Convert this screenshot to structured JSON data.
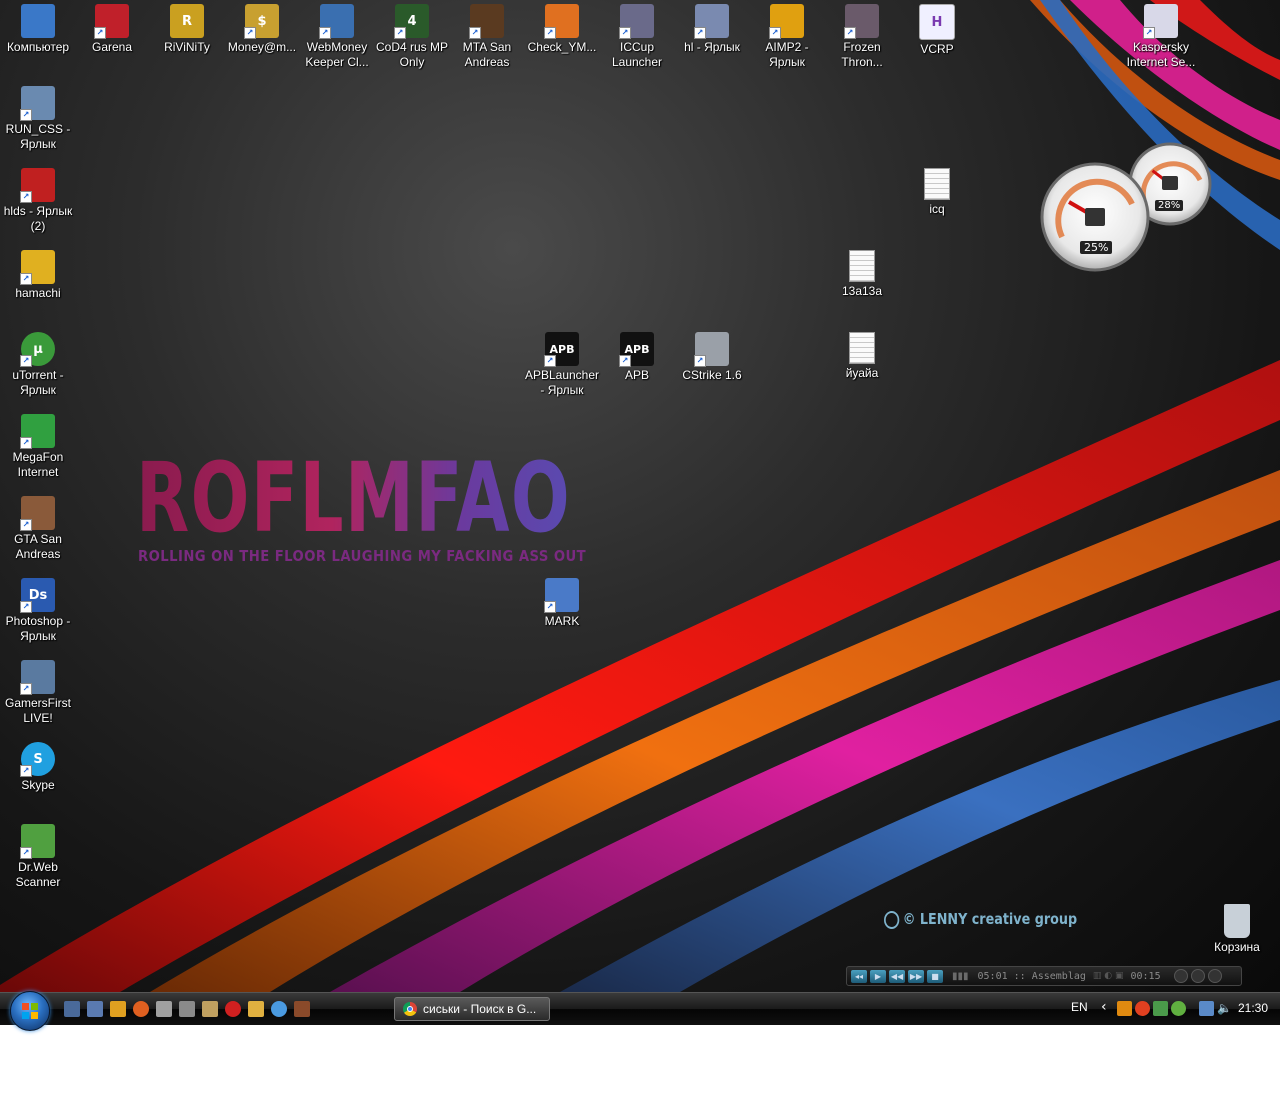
{
  "desktop": {
    "icons": [
      {
        "id": "computer",
        "label": "Компьютер",
        "glyph": "",
        "color": "#3a78c8"
      },
      {
        "id": "garena",
        "label": "Garena",
        "glyph": "",
        "color": "#c0202a"
      },
      {
        "id": "rivinity",
        "label": "RiViNiTy",
        "glyph": "R",
        "color": "#caa020"
      },
      {
        "id": "money",
        "label": "Money@m...",
        "glyph": "$",
        "color": "#c8a030"
      },
      {
        "id": "webmoney",
        "label": "WebMoney Keeper Cl...",
        "glyph": "",
        "color": "#3a6fb0"
      },
      {
        "id": "cod4",
        "label": "CoD4 rus MP Only",
        "glyph": "4",
        "color": "#2a5a2a"
      },
      {
        "id": "mta",
        "label": "MTA San Andreas",
        "glyph": "",
        "color": "#5a3a20"
      },
      {
        "id": "check",
        "label": "Check_YM...",
        "glyph": "",
        "color": "#e07020"
      },
      {
        "id": "iccup",
        "label": "ICCup Launcher",
        "glyph": "",
        "color": "#6a6a8a"
      },
      {
        "id": "hl",
        "label": "hl - Ярлык",
        "glyph": "",
        "color": "#7a8ab0"
      },
      {
        "id": "aimp2",
        "label": "AIMP2 - Ярлык",
        "glyph": "",
        "color": "#e0a010"
      },
      {
        "id": "frozen",
        "label": "Frozen Thron...",
        "glyph": "",
        "color": "#6a5a6a"
      },
      {
        "id": "vcrp",
        "label": "VCRP",
        "glyph": "H",
        "color": "#f0f0ff"
      },
      {
        "id": "kaspersky",
        "label": "Kaspersky Internet Se...",
        "glyph": "",
        "color": "#d8d8e8"
      },
      {
        "id": "run-css",
        "label": "RUN_CSS - Ярлык",
        "glyph": "",
        "color": "#6a8ab0"
      },
      {
        "id": "hlds",
        "label": "hlds - Ярлык (2)",
        "glyph": "",
        "color": "#c02020"
      },
      {
        "id": "hamachi",
        "label": "hamachi",
        "glyph": "",
        "color": "#e0b020"
      },
      {
        "id": "utorrent",
        "label": "uTorrent - Ярлык",
        "glyph": "µ",
        "color": "#3a9a3a"
      },
      {
        "id": "megafon",
        "label": "MegaFon Internet",
        "glyph": "",
        "color": "#30a040"
      },
      {
        "id": "gta-sa",
        "label": "GTA San Andreas",
        "glyph": "",
        "color": "#8a5a3a"
      },
      {
        "id": "photoshop",
        "label": "Photoshop - Ярлык",
        "glyph": "Ds",
        "color": "#2a5ab0"
      },
      {
        "id": "gamersfirst",
        "label": "GamersFirst LIVE!",
        "glyph": "",
        "color": "#5a7aa0"
      },
      {
        "id": "skype",
        "label": "Skype",
        "glyph": "S",
        "color": "#20a0e0"
      },
      {
        "id": "drweb",
        "label": "Dr.Web Scanner",
        "glyph": "",
        "color": "#50a040"
      },
      {
        "id": "icq",
        "label": "icq",
        "glyph": "",
        "color": "#f4f4f4"
      },
      {
        "id": "13a13a",
        "label": "13a13a",
        "glyph": "",
        "color": "#f4f4f4"
      },
      {
        "id": "iuaia",
        "label": "йуайа",
        "glyph": "",
        "color": "#f4f4f4"
      },
      {
        "id": "apblauncher",
        "label": "APBLauncher - Ярлык",
        "glyph": "APB",
        "color": "#111111"
      },
      {
        "id": "apb",
        "label": "APB",
        "glyph": "APB",
        "color": "#111111"
      },
      {
        "id": "cstrike",
        "label": "CStrike 1.6",
        "glyph": "",
        "color": "#9aa0a8"
      },
      {
        "id": "mark",
        "label": "MARK",
        "glyph": "",
        "color": "#4a7ac8"
      },
      {
        "id": "recycle",
        "label": "Корзина",
        "glyph": "",
        "color": "#c8d0d8"
      }
    ],
    "wallpaper_title": "ROFLMFAO",
    "wallpaper_subtitle": "ROLLING ON THE FLOOR LAUGHING MY FACKING ASS OUT",
    "wallpaper_credit": "© LENNY creative group",
    "gauges": {
      "cpu_percent": "25%",
      "memory_percent": "28%",
      "cpu_value": 25,
      "memory_value": 28
    },
    "player": {
      "track": "05:01 :: Assemblag",
      "time": "00:15"
    }
  },
  "taskbar": {
    "start_icon": "windows-orb-icon",
    "quick_launch": [
      "show-desktop-icon",
      "switch-windows-icon",
      "media-player-icon",
      "firefox-icon",
      "winamp-icon",
      "shield-icon",
      "pencil-icon",
      "opera-icon",
      "money-icon",
      "chrome-icon",
      "game-icon"
    ],
    "task_button_label": "сиськи - Поиск в G...",
    "language": "EN",
    "clock": "21:30"
  },
  "colors": {
    "accent": "#2a6fc0",
    "stripe_red": "#e01818",
    "stripe_orange": "#e06010",
    "stripe_magenta": "#d0208a",
    "stripe_blue": "#2a5a9a"
  }
}
